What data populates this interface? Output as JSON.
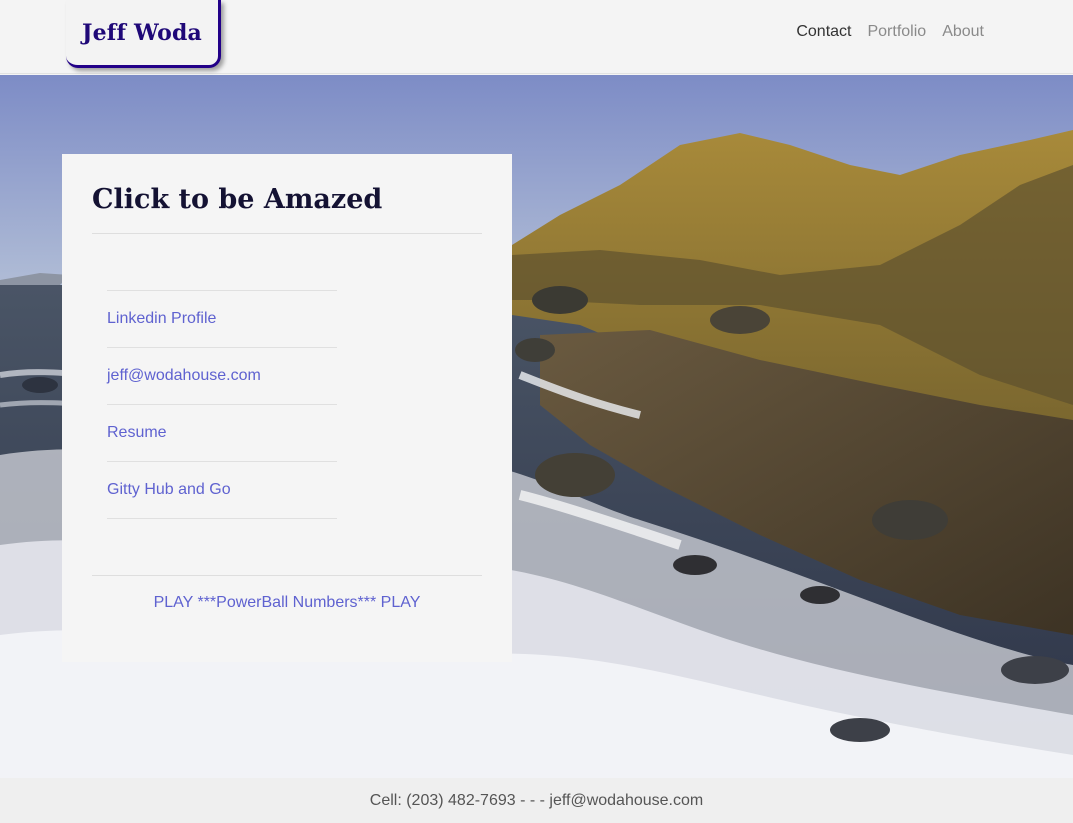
{
  "header": {
    "brand": "Jeff Woda",
    "nav": [
      {
        "label": "Contact",
        "active": true
      },
      {
        "label": "Portfolio",
        "active": false
      },
      {
        "label": "About",
        "active": false
      }
    ]
  },
  "card": {
    "title": "Click to be Amazed",
    "links": [
      {
        "label": "Linkedin Profile"
      },
      {
        "label": "jeff@wodahouse.com"
      },
      {
        "label": "Resume"
      },
      {
        "label": "Gitty Hub and Go"
      }
    ],
    "powerball": "PLAY ***PowerBall Numbers*** PLAY"
  },
  "footer": {
    "text": "Cell: (203) 482-7693 - - - jeff@wodahouse.com"
  },
  "colors": {
    "brand": "#1f0878",
    "link": "#5f62d0",
    "brand_border": "#220088"
  }
}
